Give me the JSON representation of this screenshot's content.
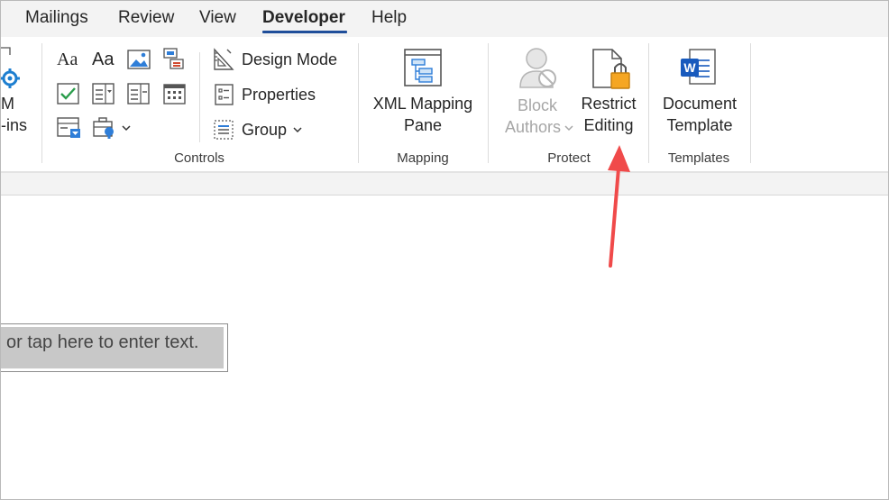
{
  "tabs": [
    {
      "label": "Mailings",
      "active": false
    },
    {
      "label": "Review",
      "active": false
    },
    {
      "label": "View",
      "active": false
    },
    {
      "label": "Developer",
      "active": true
    },
    {
      "label": "Help",
      "active": false
    }
  ],
  "ribbon": {
    "addins": {
      "line1": "M",
      "line2": "-ins"
    },
    "controls": {
      "design_mode_label": "Design Mode",
      "properties_label": "Properties",
      "group_label": "Group",
      "rich_text_glyph": "Aa",
      "plain_text_glyph": "Aa",
      "group_name": "Controls"
    },
    "mapping": {
      "xml_line1": "XML Mapping",
      "xml_line2": "Pane",
      "group_name": "Mapping"
    },
    "protect": {
      "block_line1": "Block",
      "block_line2": "Authors",
      "restrict_line1": "Restrict",
      "restrict_line2": "Editing",
      "group_name": "Protect"
    },
    "templates": {
      "doc_line1": "Document",
      "doc_line2": "Template",
      "group_name": "Templates"
    }
  },
  "document": {
    "content_control_text": "or tap here to enter text."
  },
  "colors": {
    "accent_underline": "#1f4e9a",
    "annotation_arrow": "#f04a4a",
    "lock_orange": "#f5a623",
    "word_blue": "#185abd"
  }
}
